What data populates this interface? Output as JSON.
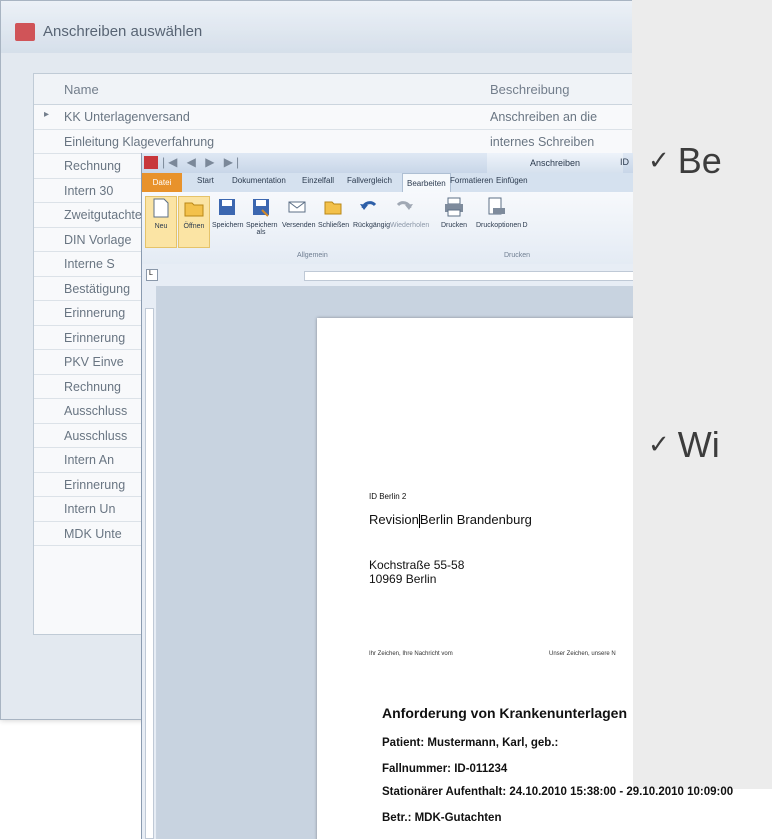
{
  "dialog": {
    "title": "Anschreiben auswählen",
    "columns": [
      "Name",
      "Beschreibung"
    ],
    "rows": [
      {
        "name": "KK Unterlagenversand",
        "desc": "Anschreiben an die"
      },
      {
        "name": "Einleitung Klageverfahrung",
        "desc": "internes Schreiben"
      },
      {
        "name": "Rechnung",
        "desc": ""
      },
      {
        "name": "Intern 30",
        "desc": ""
      },
      {
        "name": "Zweitgutachten",
        "desc": ""
      },
      {
        "name": "DIN Vorlage",
        "desc": ""
      },
      {
        "name": "Interne S",
        "desc": ""
      },
      {
        "name": "Bestätigung",
        "desc": ""
      },
      {
        "name": "Erinnerung",
        "desc": ""
      },
      {
        "name": "Erinnerung",
        "desc": ""
      },
      {
        "name": "PKV Einve",
        "desc": ""
      },
      {
        "name": "Rechnung",
        "desc": ""
      },
      {
        "name": "Ausschluss",
        "desc": ""
      },
      {
        "name": "Ausschluss",
        "desc": ""
      },
      {
        "name": "Intern An",
        "desc": ""
      },
      {
        "name": "Erinnerung",
        "desc": ""
      },
      {
        "name": "Intern Un",
        "desc": ""
      },
      {
        "name": "MDK Unte",
        "desc": ""
      }
    ]
  },
  "bullets": {
    "b1": "Be",
    "b2": "Wi",
    "check": "✓"
  },
  "word": {
    "context_tab": "Anschreiben",
    "id_label": "ID",
    "tabs": {
      "datei": "Datei",
      "start": "Start",
      "dokumentation": "Dokumentation",
      "einzelfall": "Einzelfall",
      "fallvergleich": "Fallvergleich",
      "bearbeiten": "Bearbeiten",
      "formatieren": "Formatieren",
      "einfuegen": "Einfügen"
    },
    "ribbon": {
      "neu": "Neu",
      "oeffnen": "Öffnen",
      "speichern": "Speichern",
      "speichern_als_1": "Speichern",
      "speichern_als_2": "als",
      "versenden": "Versenden",
      "schliessen": "Schließen",
      "rueckgaengig": "Rückgängig",
      "wiederholen": "Wiederholen",
      "drucken": "Drucken",
      "druckoptionen": "Druckoptionen",
      "d": "D",
      "group_allgemein": "Allgemein",
      "group_drucken": "Drucken"
    },
    "ruler_corner": "L"
  },
  "letter": {
    "sender_small": "ID Berlin 2",
    "recipient_line1_a": "Revision",
    "recipient_line1_b": "Berlin Brandenburg",
    "address_street": "Kochstraße 55-58",
    "address_city": "10969 Berlin",
    "ref_left": "Ihr Zeichen, Ihre Nachricht vom",
    "ref_right": "Unser Zeichen, unsere N",
    "subject": "Anforderung von Krankenunterlagen",
    "patient": "Patient: Mustermann, Karl, geb.:",
    "fallnummer": "Fallnummer: ID-011234",
    "aufenthalt": "Stationärer Aufenthalt: 24.10.2010 15:38:00 - 29.10.2010 10:09:00",
    "betreff": "Betr.: MDK-Gutachten"
  }
}
